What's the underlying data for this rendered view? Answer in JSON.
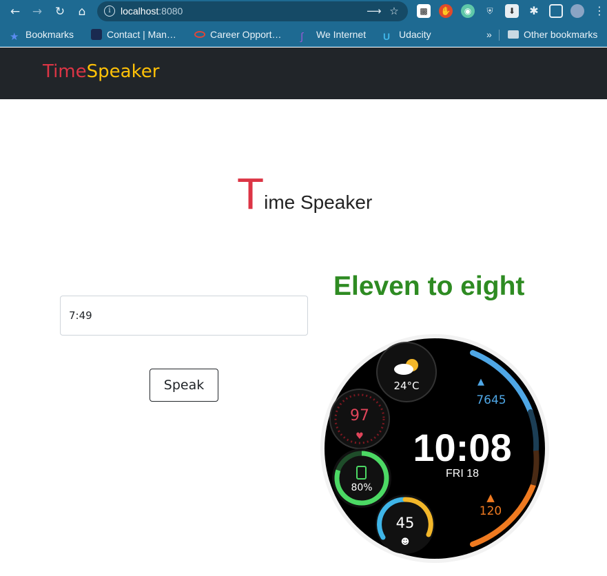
{
  "browser": {
    "url_host": "localhost",
    "url_port": ":8080",
    "bookmarks": [
      {
        "label": "Bookmarks",
        "icon": "star-icon"
      },
      {
        "label": "Contact | Man…",
        "icon": "site-icon"
      },
      {
        "label": "Career Opport…",
        "icon": "oracle-icon"
      },
      {
        "label": "We Internet",
        "icon": "we-icon"
      },
      {
        "label": "Udacity",
        "icon": "udacity-icon"
      }
    ],
    "other_bookmarks": "Other bookmarks",
    "overflow": "»"
  },
  "navbar": {
    "brand_part1": "Time",
    "brand_part2": "Speaker"
  },
  "main": {
    "title_initial": "T",
    "title_rest": "ime Speaker",
    "time_input_value": "7:49",
    "speak_label": "Speak",
    "result_text": "Eleven to eight"
  },
  "watch": {
    "time": "10:08",
    "date": "FRI 18",
    "temperature": "24°C",
    "heart_rate": "97",
    "battery": "80%",
    "steps": "7645",
    "calories": "120",
    "activity": "45"
  },
  "colors": {
    "browser_frame": "#1e6a92",
    "navbar_bg": "#212529",
    "brand_red": "#dc3545",
    "brand_yellow": "#ffc107",
    "result_green": "#2e8b22"
  }
}
